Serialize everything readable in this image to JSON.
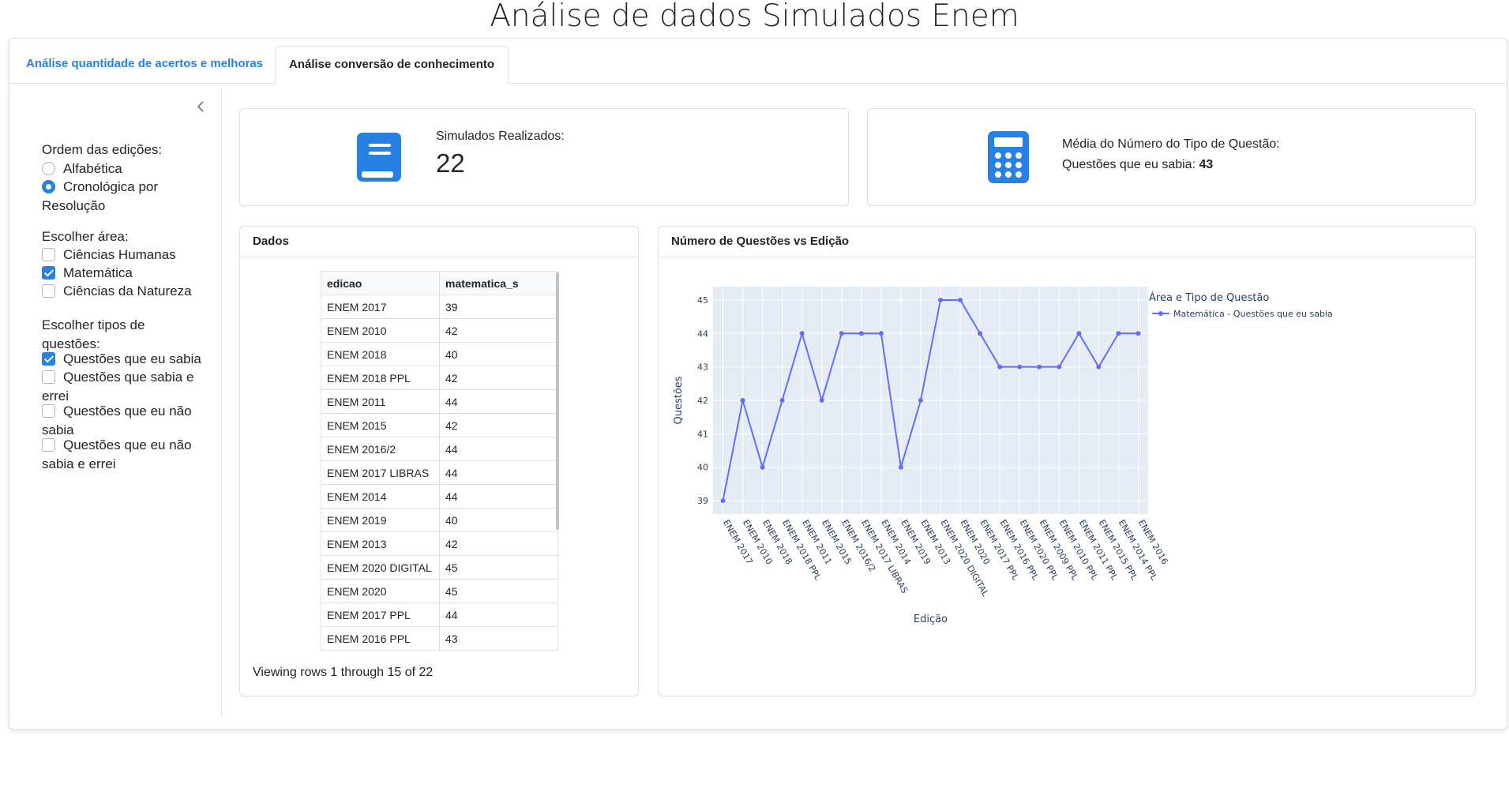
{
  "page_title": "Análise de dados Simulados Enem",
  "tabs": [
    "Análise quantidade de acertos e melhoras",
    "Análise conversão de conhecimento"
  ],
  "sidebar": {
    "order_label": "Ordem das edições:",
    "order_options": [
      {
        "label": "Alfabética",
        "checked": false
      },
      {
        "label": "Cronológica por Resolução",
        "checked": true
      }
    ],
    "area_label": "Escolher área:",
    "area_options": [
      {
        "label": "Ciências Humanas",
        "checked": false
      },
      {
        "label": "Matemática",
        "checked": true
      },
      {
        "label": "Ciências da Natureza",
        "checked": false
      }
    ],
    "types_label": "Escolher tipos de questões:",
    "type_options": [
      {
        "label": "Questões que eu sabia",
        "checked": true
      },
      {
        "label": "Questões que sabia e errei",
        "checked": false
      },
      {
        "label": "Questões que eu não sabia",
        "checked": false
      },
      {
        "label": "Questões que eu não sabia e errei",
        "checked": false
      }
    ]
  },
  "value_boxes": {
    "simulados_title": "Simulados Realizados:",
    "simulados_value": "22",
    "media_title": "Média do Número do Tipo de Questão:",
    "media_line_label": "Questões que eu sabia:",
    "media_line_value": "43"
  },
  "table": {
    "title": "Dados",
    "columns": [
      "edicao",
      "matematica_s"
    ],
    "rows": [
      [
        "ENEM 2017",
        "39"
      ],
      [
        "ENEM 2010",
        "42"
      ],
      [
        "ENEM 2018",
        "40"
      ],
      [
        "ENEM 2018 PPL",
        "42"
      ],
      [
        "ENEM 2011",
        "44"
      ],
      [
        "ENEM 2015",
        "42"
      ],
      [
        "ENEM 2016/2",
        "44"
      ],
      [
        "ENEM 2017 LIBRAS",
        "44"
      ],
      [
        "ENEM 2014",
        "44"
      ],
      [
        "ENEM 2019",
        "40"
      ],
      [
        "ENEM 2013",
        "42"
      ],
      [
        "ENEM 2020 DIGITAL",
        "45"
      ],
      [
        "ENEM 2020",
        "45"
      ],
      [
        "ENEM 2017 PPL",
        "44"
      ],
      [
        "ENEM 2016 PPL",
        "43"
      ]
    ],
    "footer": "Viewing rows 1 through 15 of 22"
  },
  "chart_panel_title": "Número de Questões vs Edição",
  "colors": {
    "accent": "#2780e3",
    "series": "#636efa",
    "plot_bg": "#e5ecf6"
  },
  "icons": {
    "simulados": "book-icon",
    "media": "calculator-icon",
    "collapse": "chevron-left-icon"
  },
  "chart_data": {
    "type": "line",
    "x": [
      "ENEM 2017",
      "ENEM 2010",
      "ENEM 2018",
      "ENEM 2018 PPL",
      "ENEM 2011",
      "ENEM 2015",
      "ENEM 2016/2",
      "ENEM 2017 LIBRAS",
      "ENEM 2014",
      "ENEM 2019",
      "ENEM 2013",
      "ENEM 2020 DIGITAL",
      "ENEM 2020",
      "ENEM 2017 PPL",
      "ENEM 2016 PPL",
      "ENEM 2020 PPL",
      "ENEM 2009 PPL",
      "ENEM 2010 PPL",
      "ENEM 2011 PPL",
      "ENEM 2015 PPL",
      "ENEM 2014 PPL",
      "ENEM 2016"
    ],
    "series": [
      {
        "name": "Matemática - Questões que eu sabia",
        "values": [
          39,
          42,
          40,
          42,
          44,
          42,
          44,
          44,
          44,
          40,
          42,
          45,
          45,
          44,
          43,
          43,
          43,
          43,
          44,
          43,
          44,
          44
        ]
      }
    ],
    "xlabel": "Edição",
    "ylabel": "Questões",
    "legend_title": "Área e Tipo de Questão",
    "legend_position": "top-right",
    "yticks": [
      39,
      40,
      41,
      42,
      43,
      44,
      45
    ],
    "ylim": [
      38.6,
      45.4
    ],
    "grid": true
  }
}
